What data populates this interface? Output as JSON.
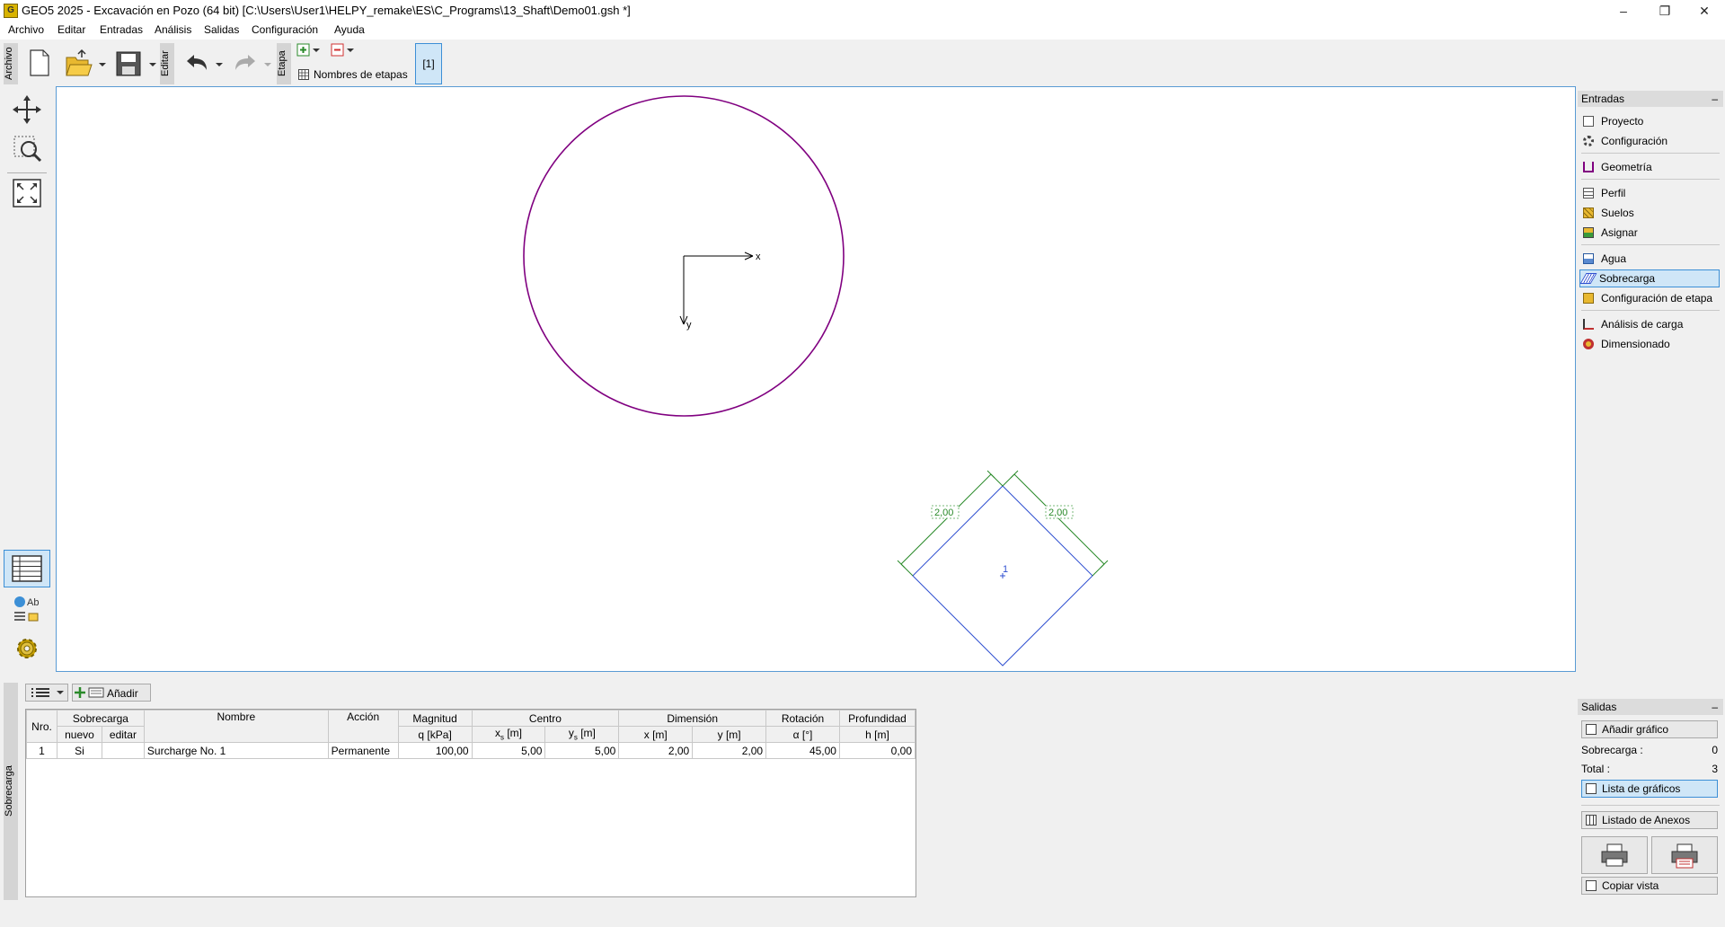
{
  "window": {
    "title": "GEO5 2025 - Excavación en Pozo (64 bit) [C:\\Users\\User1\\HELPY_remake\\ES\\C_Programs\\13_Shaft\\Demo01.gsh *]",
    "icon_text": "G",
    "minimize": "–",
    "restore": "❐",
    "close": "✕"
  },
  "menu": [
    "Archivo",
    "Editar",
    "Entradas",
    "Análisis",
    "Salidas",
    "Configuración",
    "Ayuda"
  ],
  "toolbar": {
    "archivo_label": "Archivo",
    "editar_label": "Editar",
    "etapa_label": "Etapa",
    "stage_names_label": "Nombres de etapas",
    "current_stage": "[1]"
  },
  "canvas": {
    "axis_x": "x",
    "axis_y": "y",
    "surcharge_label": "1",
    "dim_left": "2,00",
    "dim_right": "2,00"
  },
  "bottom": {
    "vertical_label": "Sobrecarga",
    "add_button": "Añadir",
    "table": {
      "header_row1": {
        "nro": "Nro.",
        "sobrecarga": "Sobrecarga",
        "nombre": "Nombre",
        "accion": "Acción",
        "magnitud": "Magnitud",
        "centro": "Centro",
        "dimension": "Dimensión",
        "rotacion": "Rotación",
        "profundidad": "Profundidad"
      },
      "header_row2": {
        "nuevo": "nuevo",
        "editar": "editar",
        "q": "q [kPa]",
        "xs": "x",
        "xs_sub": "s",
        "xs_unit": " [m]",
        "ys": "y",
        "ys_sub": "s",
        "ys_unit": " [m]",
        "x": "x [m]",
        "y": "y [m]",
        "alpha": "α [°]",
        "h": "h [m]"
      },
      "rows": [
        {
          "nro": "1",
          "nuevo": "Si",
          "editar": "",
          "nombre": "Surcharge No. 1",
          "accion": "Permanente",
          "q": "100,00",
          "xs": "5,00",
          "ys": "5,00",
          "x": "2,00",
          "y": "2,00",
          "alpha": "45,00",
          "h": "0,00"
        }
      ]
    }
  },
  "right_panel": {
    "entradas_header": "Entradas",
    "collapse": "–",
    "groups": [
      [
        {
          "label": "Proyecto",
          "icon": "document-icon"
        },
        {
          "label": "Configuración",
          "icon": "gear-icon"
        }
      ],
      [
        {
          "label": "Geometría",
          "icon": "shaft-geometry-icon"
        }
      ],
      [
        {
          "label": "Perfil",
          "icon": "profile-icon"
        },
        {
          "label": "Suelos",
          "icon": "soil-icon"
        },
        {
          "label": "Asignar",
          "icon": "assign-icon"
        }
      ],
      [
        {
          "label": "Agua",
          "icon": "water-icon"
        },
        {
          "label": "Sobrecarga",
          "icon": "surcharge-icon"
        },
        {
          "label": "Configuración de etapa",
          "icon": "stage-settings-icon"
        }
      ],
      [
        {
          "label": "Análisis de carga",
          "icon": "load-analysis-icon"
        },
        {
          "label": "Dimensionado",
          "icon": "dimensioning-icon"
        }
      ]
    ],
    "selected": "Sobrecarga",
    "salidas_header": "Salidas",
    "add_graphic": "Añadir gráfico",
    "sobrecarga_label": "Sobrecarga :",
    "sobrecarga_count": "0",
    "total_label": "Total :",
    "total_count": "3",
    "list_graphics": "Lista de gráficos",
    "list_annexes": "Listado de Anexos",
    "copy_view": "Copiar vista"
  },
  "colors": {
    "shaft": "#800080",
    "surcharge": "#3050d0",
    "dimension": "#2a8a2a",
    "selected_bg": "#cfe6f7",
    "selected_border": "#3c8fd6"
  }
}
